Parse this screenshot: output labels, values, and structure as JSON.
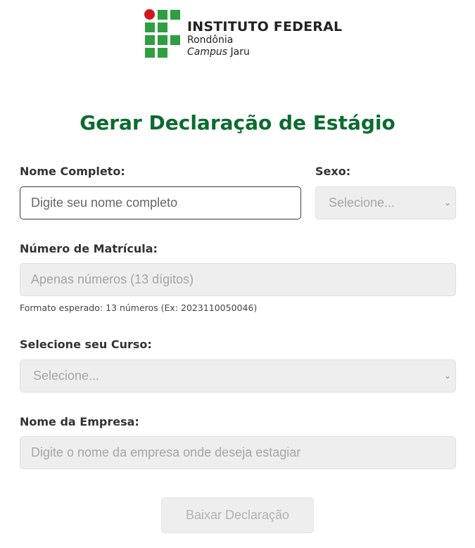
{
  "logo": {
    "title": "INSTITUTO FEDERAL",
    "state": "Rondônia",
    "campus_label": "Campus",
    "campus_name": " Jaru",
    "colors": {
      "green": "#2f9e41",
      "red": "#cd191e"
    }
  },
  "page_title": "Gerar Declaração de Estágio",
  "form": {
    "nome": {
      "label": "Nome Completo:",
      "placeholder": "Digite seu nome completo"
    },
    "sexo": {
      "label": "Sexo:",
      "selected": "Selecione..."
    },
    "matricula": {
      "label": "Número de Matrícula:",
      "placeholder": "Apenas números (13 dígitos)",
      "hint": "Formato esperado: 13 números (Ex: 2023110050046)"
    },
    "curso": {
      "label": "Selecione seu Curso:",
      "selected": "Selecione..."
    },
    "empresa": {
      "label": "Nome da Empresa:",
      "placeholder": "Digite o nome da empresa onde deseja estagiar"
    },
    "submit_label": "Baixar Declaração"
  },
  "colors": {
    "title": "#0b6b2f",
    "disabled_bg": "#eeeeee"
  }
}
